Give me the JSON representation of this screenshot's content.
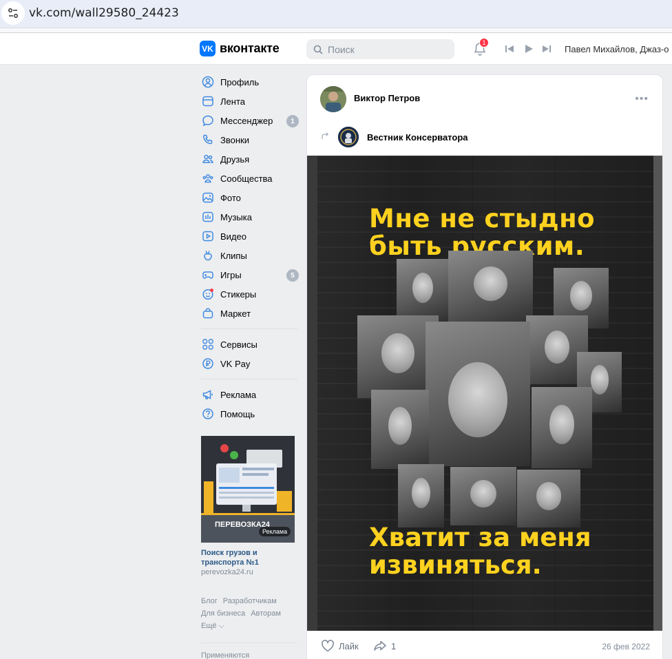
{
  "browser": {
    "url": "vk.com/wall29580_24423"
  },
  "header": {
    "logo_text": "вконтакте",
    "search_placeholder": "Поиск",
    "notifications_count": "1",
    "now_playing": "Павел Михайлов, Джаз-о"
  },
  "nav": {
    "items": [
      {
        "label": "Профиль",
        "icon": "profile-icon"
      },
      {
        "label": "Лента",
        "icon": "feed-icon"
      },
      {
        "label": "Мессенджер",
        "icon": "messenger-icon",
        "count": "1"
      },
      {
        "label": "Звонки",
        "icon": "phone-icon"
      },
      {
        "label": "Друзья",
        "icon": "friends-icon"
      },
      {
        "label": "Сообщества",
        "icon": "communities-icon"
      },
      {
        "label": "Фото",
        "icon": "photo-icon"
      },
      {
        "label": "Музыка",
        "icon": "music-icon"
      },
      {
        "label": "Видео",
        "icon": "video-icon"
      },
      {
        "label": "Клипы",
        "icon": "clips-icon"
      },
      {
        "label": "Игры",
        "icon": "games-icon",
        "count": "5"
      },
      {
        "label": "Стикеры",
        "icon": "stickers-icon"
      },
      {
        "label": "Маркет",
        "icon": "market-icon"
      }
    ],
    "services": [
      {
        "label": "Сервисы",
        "icon": "services-icon"
      },
      {
        "label": "VK Pay",
        "icon": "vkpay-icon"
      }
    ],
    "extra": [
      {
        "label": "Реклама",
        "icon": "megaphone-icon"
      },
      {
        "label": "Помощь",
        "icon": "help-icon"
      }
    ]
  },
  "ad": {
    "brand": "ПЕРЕВОЗКА24",
    "badge": "Реклама",
    "title": "Поиск грузов и транспорта №1",
    "host": "perevozka24.ru"
  },
  "footer": {
    "links": [
      "Блог",
      "Разработчикам",
      "Для бизнеса",
      "Авторам",
      "Ещё ⌵"
    ],
    "note": "Применяются"
  },
  "post": {
    "author": "Виктор Петров",
    "repost_source": "Вестник Консерватора",
    "poster_headline_1": "Мне не стыдно",
    "poster_headline_2": "быть русским.",
    "poster_tagline_1": "Хватит за меня",
    "poster_tagline_2": "извиняться.",
    "like_label": "Лайк",
    "share_count": "1",
    "date": "26 фев 2022"
  },
  "colors": {
    "accent": "#0077ff",
    "poster_text": "#ffd21f",
    "badge_red": "#ff3347"
  }
}
